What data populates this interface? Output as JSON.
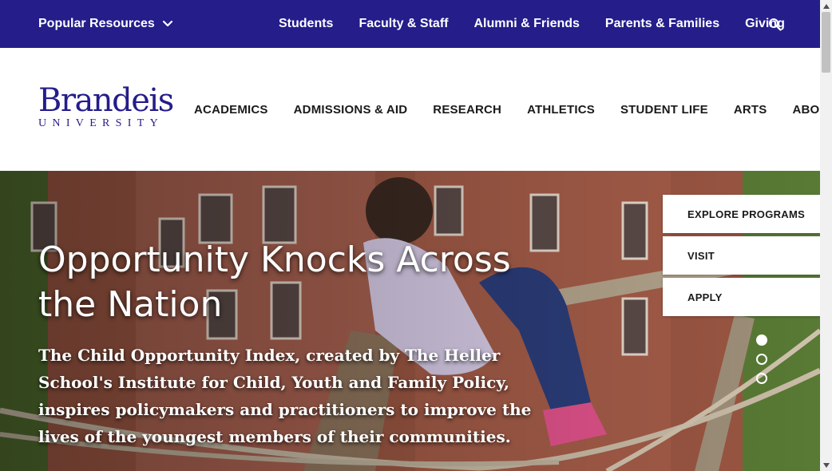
{
  "topbar": {
    "popular_label": "Popular Resources",
    "links": [
      "Students",
      "Faculty & Staff",
      "Alumni & Friends",
      "Parents & Families",
      "Giving"
    ],
    "search_icon": "search-icon",
    "background": "#241d8a"
  },
  "logo": {
    "name": "Brandeis",
    "sub": "UNIVERSITY",
    "color": "#241d8a"
  },
  "nav": {
    "items": [
      "ACADEMICS",
      "ADMISSIONS & AID",
      "RESEARCH",
      "ATHLETICS",
      "STUDENT LIFE",
      "ARTS",
      "ABOUT"
    ]
  },
  "hero": {
    "title": "Opportunity Knocks Across the Nation",
    "description": "The Child Opportunity Index, created by The Heller School's Institute for Child, Youth and Family Policy, inspires policymakers and practitioners to improve the lives of the youngest members of their communities.",
    "ctas": [
      "EXPLORE PROGRAMS",
      "VISIT",
      "APPLY"
    ],
    "slides": {
      "count": 3,
      "active": 1
    }
  }
}
